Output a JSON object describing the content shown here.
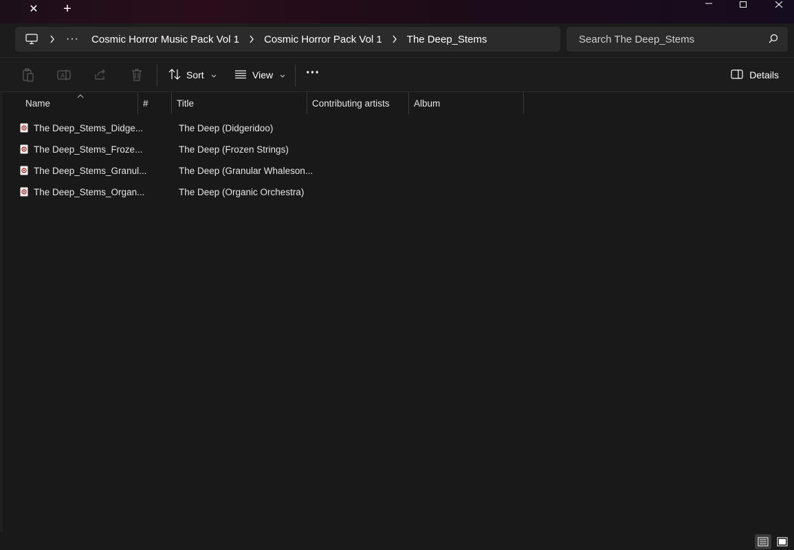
{
  "window": {
    "tab_close_glyph": "✕",
    "tab_add_glyph": "+",
    "minimize_glyph": "—",
    "maximize_glyph": "☐",
    "close_glyph": "✕"
  },
  "address": {
    "more_glyph": "···",
    "breadcrumbs": [
      {
        "label": "Cosmic Horror Music Pack Vol 1"
      },
      {
        "label": "Cosmic Horror Pack Vol 1"
      },
      {
        "label": "The Deep_Stems"
      }
    ],
    "search_placeholder": "Search The Deep_Stems"
  },
  "toolbar": {
    "sort_label": "Sort",
    "view_label": "View",
    "more_glyph": "···",
    "details_label": "Details"
  },
  "columns": {
    "name": "Name",
    "number": "#",
    "title": "Title",
    "artists": "Contributing artists",
    "album": "Album"
  },
  "files": [
    {
      "name": "The Deep_Stems_Didge...",
      "title": "The Deep (Didgeridoo)"
    },
    {
      "name": "The Deep_Stems_Froze...",
      "title": "The Deep (Frozen Strings)"
    },
    {
      "name": "The Deep_Stems_Granul...",
      "title": "The Deep (Granular Whaleson..."
    },
    {
      "name": "The Deep_Stems_Organ...",
      "title": "The Deep (Organic Orchestra)"
    }
  ],
  "colors": {
    "background": "#191919",
    "bar": "#2b2b2b",
    "text": "#ffffff",
    "file_icon_accent": "#c42b1c"
  }
}
